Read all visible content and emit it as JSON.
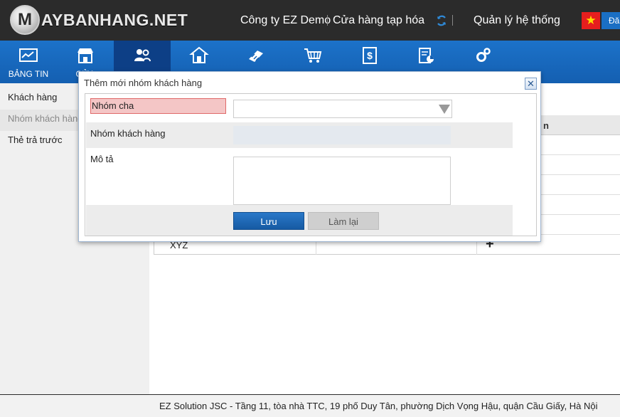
{
  "header": {
    "logo_letter": "M",
    "logo_text": "AYBANHANG.NET",
    "company": "Công ty EZ Demo",
    "store": "Cửa hàng tạp hóa",
    "admin": "Quản lý hệ thống",
    "logout_label": "Đă",
    "flag_icon": "vietnam-flag-icon",
    "sync_icon": "sync-icon"
  },
  "nav": {
    "items": [
      {
        "label": "BẢNG TIN",
        "icon": "dashboard-icon"
      },
      {
        "label": "CỬA",
        "icon": "store-icon"
      },
      {
        "label": "",
        "icon": "customers-icon"
      },
      {
        "label": "",
        "icon": "warehouse-icon"
      },
      {
        "label": "",
        "icon": "products-icon"
      },
      {
        "label": "",
        "icon": "cart-icon"
      },
      {
        "label": "",
        "icon": "money-icon"
      },
      {
        "label": "",
        "icon": "report-icon"
      },
      {
        "label": "",
        "icon": "settings-icon"
      }
    ]
  },
  "sidebar": {
    "items": [
      {
        "label": "Khách hàng"
      },
      {
        "label": "Nhóm khách hàng"
      },
      {
        "label": "Thẻ trả trước"
      }
    ]
  },
  "table": {
    "header_fragment": "n",
    "last_row_name": "XYZ"
  },
  "modal": {
    "title": "Thêm mới nhóm khách hàng",
    "close_symbol": "✕",
    "fields": {
      "parent_group_label": "Nhóm cha",
      "group_name_label": "Nhóm khách hàng",
      "description_label": "Mô tả"
    },
    "buttons": {
      "save": "Lưu",
      "reset": "Làm lại"
    }
  },
  "footer": {
    "text": "EZ Solution JSC - Tầng 11, tòa nhà TTC, 19 phố Duy Tân, phường Dịch Vọng Hậu, quận Cầu Giấy, Hà Nội"
  },
  "colors": {
    "header_bg": "#2b2b2b",
    "nav_bg": "#1c72c9",
    "nav_active": "#0d3f86",
    "accent": "#165aa3",
    "error_bg": "#f4c6c6"
  }
}
